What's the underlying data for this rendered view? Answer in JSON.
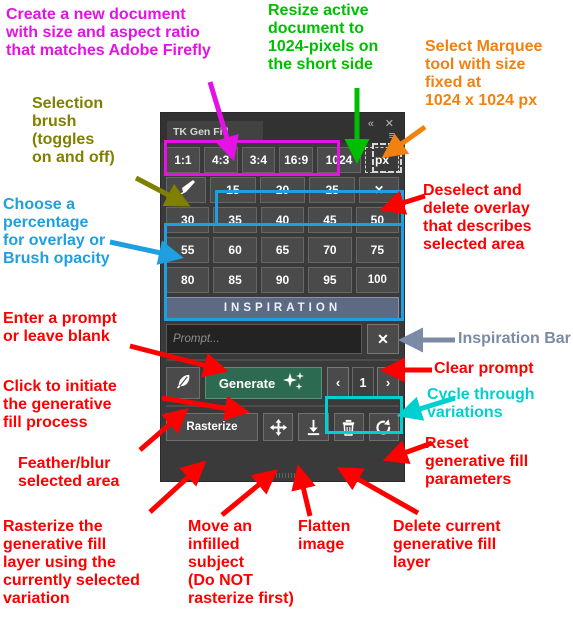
{
  "panel": {
    "title": "TK Gen Fill",
    "titlebar_icons": {
      "collapse": "«",
      "close": "✕",
      "menu": "≡"
    },
    "aspect_ratio_buttons": [
      "1:1",
      "4:3",
      "3:4",
      "16:9"
    ],
    "size_value": "1024",
    "size_unit": "px",
    "brush_icon": "selection-brush-icon",
    "percent_row_top": [
      "15",
      "20",
      "25"
    ],
    "deselect_label": "✕",
    "percent_rows": [
      [
        "30",
        "35",
        "40",
        "45",
        "50"
      ],
      [
        "55",
        "60",
        "65",
        "70",
        "75"
      ],
      [
        "80",
        "85",
        "90",
        "95",
        "100"
      ]
    ],
    "inspiration_label": "INSPIRATION",
    "prompt_value": "",
    "prompt_placeholder": "Prompt...",
    "clear_prompt_label": "✕",
    "feather_icon": "feather-icon",
    "generate_label": "Generate",
    "variation": {
      "prev": "‹",
      "current": "1",
      "next": "›"
    },
    "rasterize_label": "Rasterize",
    "tool_icons": [
      "move-icon",
      "flatten-icon",
      "trash-icon",
      "reset-icon"
    ]
  },
  "annotations": {
    "new_document": "Create a new document\nwith size and aspect ratio\nthat matches Adobe Firefly",
    "resize": "Resize active\ndocument to\n1024-pixels on\nthe short side",
    "marquee": "Select Marquee\ntool with size\nfixed at\n1024 x 1024 px",
    "selection_brush": "Selection\nbrush\n(toggles\non and off)",
    "percentage": "Choose a\npercentage\nfor overlay or\nBrush opacity",
    "deselect": "Deselect and\ndelete overlay\nthat describes\nselected area",
    "inspiration_bar": "Inspiration Bar",
    "enter_prompt": "Enter a prompt\nor leave blank",
    "clear_prompt": "Clear prompt",
    "click_generate": "Click to initiate\nthe generative\nfill process",
    "cycle_variations": "Cycle through\nvariations",
    "feather": "Feather/blur\nselected area",
    "reset": "Reset\ngenerative fill\nparameters",
    "rasterize": "Rasterize the\ngenerative fill\nlayer using the\ncurrently selected\nvariation",
    "move": "Move an\ninfilled\nsubject\n(Do NOT\nrasterize first)",
    "flatten": "Flatten\nimage",
    "delete_layer": "Delete current\ngenerative fill\nlayer"
  },
  "colors": {
    "magenta": "#e512e5",
    "green": "#00bf00",
    "orange": "#f28110",
    "olive": "#808000",
    "blue": "#1e9fe0",
    "red": "#ff0000",
    "slate": "#7b8aa5",
    "teal": "#00d0d0",
    "panel_bg": "#3a3a3a",
    "generate_bg": "#2c6b52"
  }
}
